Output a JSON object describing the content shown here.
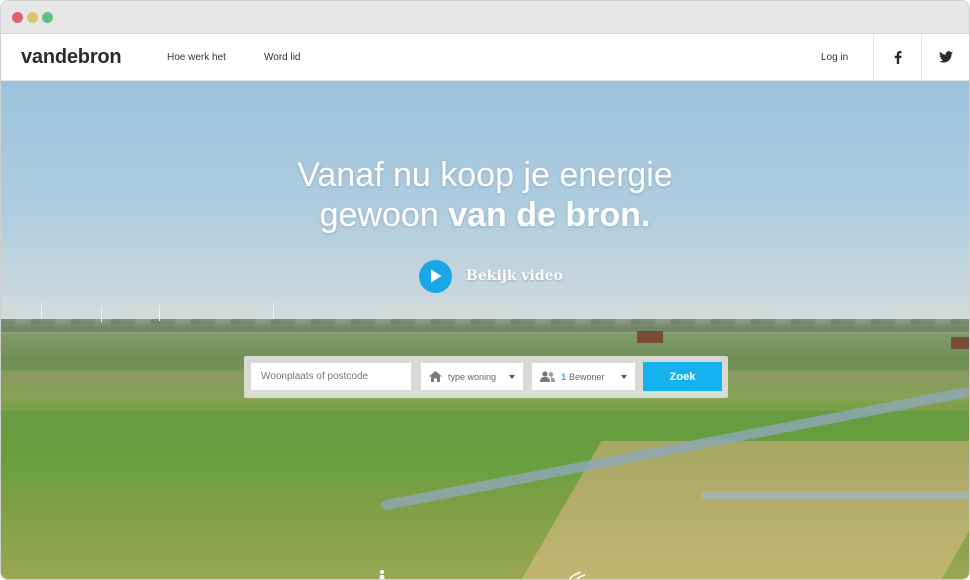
{
  "window": {
    "controls": [
      "close",
      "minimize",
      "maximize"
    ],
    "control_colors": [
      "#e0606e",
      "#d9c56a",
      "#5fbf8a"
    ]
  },
  "nav": {
    "logo": "vandebron",
    "links": [
      "Hoe werk het",
      "Word lid"
    ],
    "login": "Log in",
    "social": [
      "facebook-icon",
      "twitter-icon"
    ]
  },
  "hero": {
    "headline_line1": "Vanaf nu koop je energie",
    "headline_line2_prefix": "gewoon",
    "headline_line2_bold": "van de bron.",
    "video_label": "Bekijk video"
  },
  "search": {
    "placeholder": "Woonplaats of postcode",
    "type_select": "type woning",
    "residents_count": "1",
    "residents_label": "Bewoner",
    "button": "Zoek"
  },
  "colors": {
    "accent": "#14b3ef",
    "play": "#1ba7e6",
    "text_dark": "#2b2b2b"
  }
}
